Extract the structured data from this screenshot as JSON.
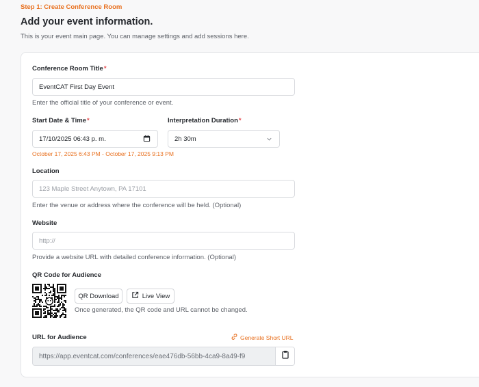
{
  "header": {
    "step": "Step 1: Create Conference Room",
    "title": "Add your event information.",
    "subtitle": "This is your event main page. You can manage settings and add sessions here."
  },
  "form": {
    "title_field": {
      "label": "Conference Room Title",
      "required_mark": "*",
      "value": "EventCAT First Day Event",
      "hint": "Enter the official title of your conference or event."
    },
    "start_field": {
      "label": "Start Date & Time",
      "required_mark": "*",
      "value": "17/10/2025 06:43 p. m.",
      "range_note": "October 17, 2025 6:43 PM - October 17, 2025 9:13 PM"
    },
    "duration_field": {
      "label": "Interpretation Duration",
      "required_mark": "*",
      "value": "2h 30m"
    },
    "location_field": {
      "label": "Location",
      "placeholder": "123 Maple Street Anytown, PA 17101",
      "hint": "Enter the venue or address where the conference will be held. (Optional)"
    },
    "website_field": {
      "label": "Website",
      "placeholder": "http://",
      "hint": "Provide a website URL with detailed conference information. (Optional)"
    },
    "qr_section": {
      "label": "QR Code for Audience",
      "download_label": "QR Download",
      "live_view_label": "Live View",
      "note": "Once generated, the QR code and URL cannot be changed."
    },
    "url_section": {
      "label": "URL for Audience",
      "generate_short_url": "Generate Short URL",
      "url": "https://app.eventcat.com/conferences/eae476db-56bb-4ca9-8a49-f9"
    }
  },
  "colors": {
    "accent": "#e8701f",
    "required": "#e5484d",
    "border": "#d9dbdf"
  },
  "icons": {
    "calendar": "calendar-icon",
    "chevron": "chevron-down-icon",
    "external_link": "external-link-icon",
    "link": "link-icon",
    "clipboard": "clipboard-icon"
  }
}
